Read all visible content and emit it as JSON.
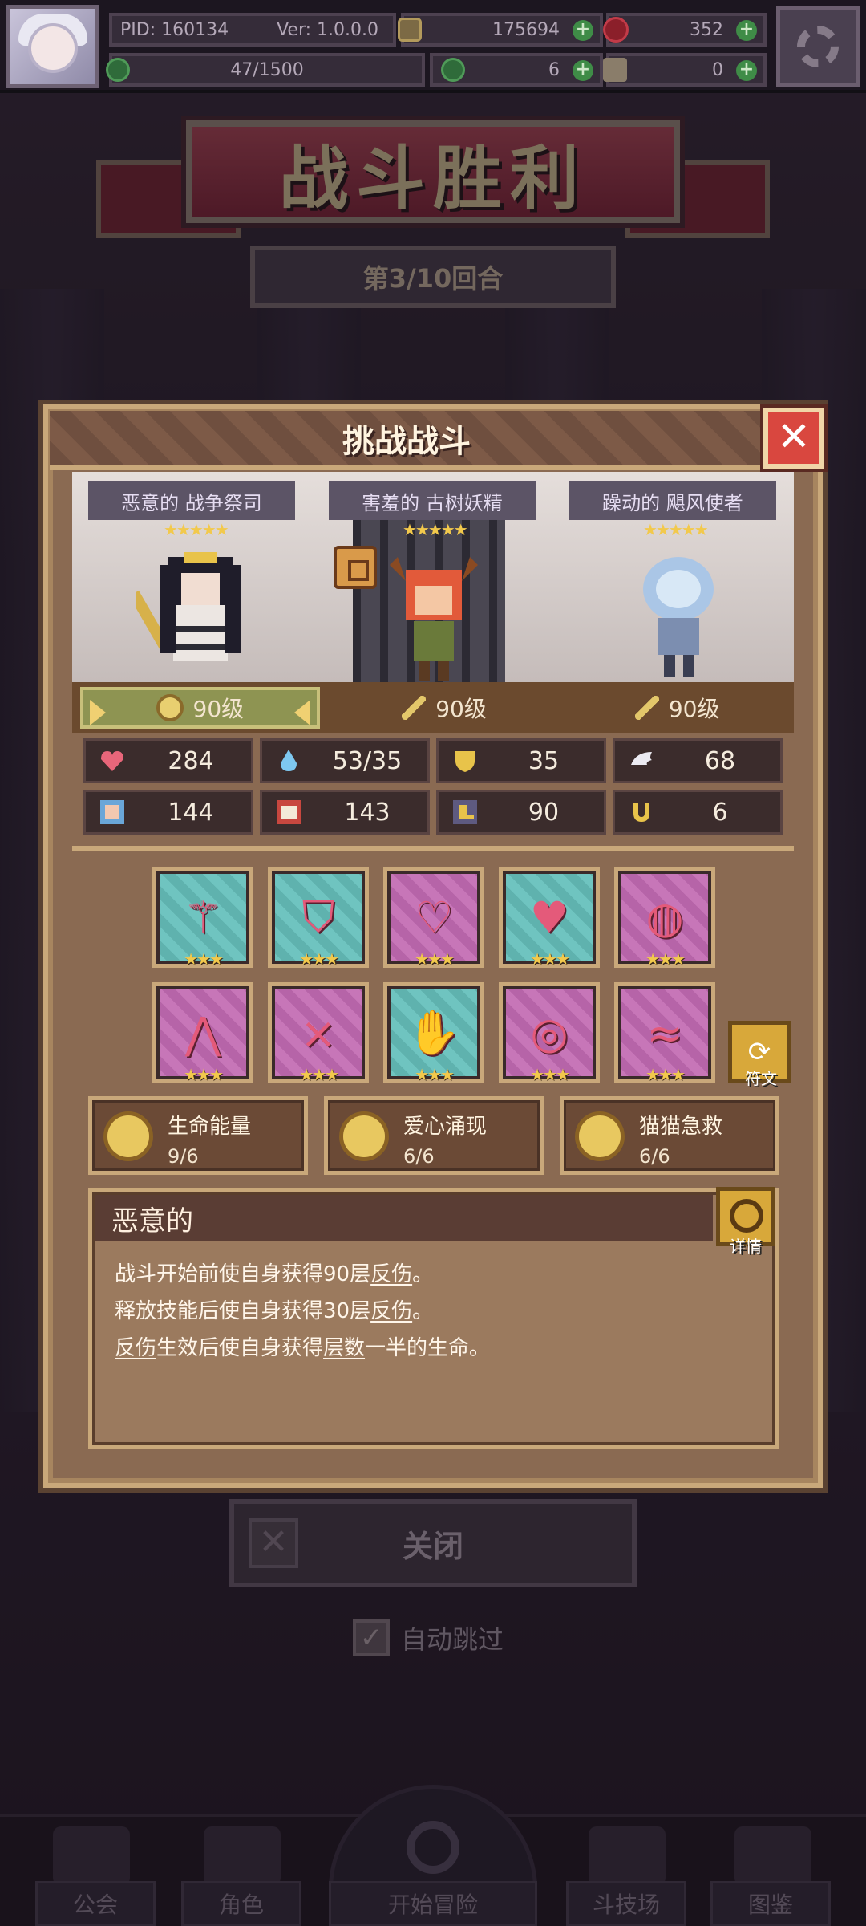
{
  "topbar": {
    "pid": "PID: 160134",
    "version": "Ver: 1.0.0.0",
    "gold": "175694",
    "gems": "352",
    "exp": "47/1500",
    "clover": "6",
    "keys": "0",
    "plus": "+"
  },
  "banner": {
    "title": "战斗胜利",
    "round": "第3/10回合"
  },
  "modal": {
    "title": "挑战战斗",
    "close": "✕",
    "heroes": [
      {
        "name": "恶意的 战争祭司",
        "stars": "★★★★★",
        "level": "90级"
      },
      {
        "name": "害羞的 古树妖精",
        "stars": "★★★★★",
        "level": "90级"
      },
      {
        "name": "躁动的 飓风使者",
        "stars": "★★★★★",
        "level": "90级"
      }
    ],
    "stats": [
      {
        "icon": "heart-icon",
        "value": "284"
      },
      {
        "icon": "mana-drop-icon",
        "value": "53/35"
      },
      {
        "icon": "shield-icon",
        "value": "35"
      },
      {
        "icon": "wing-icon",
        "value": "68"
      },
      {
        "icon": "fist-icon",
        "value": "144"
      },
      {
        "icon": "spellbook-icon",
        "value": "143"
      },
      {
        "icon": "boot-icon",
        "value": "90"
      },
      {
        "icon": "horseshoe-icon",
        "value": "6"
      }
    ],
    "equipment": [
      {
        "icon": "heart-wand-icon",
        "bg": "teal",
        "glyph": "⚚",
        "stars": "★★★"
      },
      {
        "icon": "heart-shield-icon",
        "bg": "teal",
        "glyph": "⛉",
        "stars": "★★★"
      },
      {
        "icon": "heart-necklace-icon",
        "bg": "pink",
        "glyph": "♡",
        "stars": "★★★"
      },
      {
        "icon": "heart-locket-icon",
        "bg": "teal",
        "glyph": "♥",
        "stars": "★★★"
      },
      {
        "icon": "ruby-ring-icon",
        "bg": "pink",
        "glyph": "◍",
        "stars": "★★★"
      },
      {
        "icon": "cat-ear-headband-icon",
        "bg": "pink",
        "glyph": "⋀",
        "stars": "★★★"
      },
      {
        "icon": "ribbon-bow-icon",
        "bg": "pink",
        "glyph": "⨯",
        "stars": "★★★"
      },
      {
        "icon": "cat-paw-glove-icon",
        "bg": "teal",
        "glyph": "✋",
        "stars": "★★★"
      },
      {
        "icon": "gem-collar-icon",
        "bg": "pink",
        "glyph": "◎",
        "stars": "★★★"
      },
      {
        "icon": "winged-boots-icon",
        "bg": "pink",
        "glyph": "≈",
        "stars": "★★★"
      }
    ],
    "rune_label": "符文",
    "rune_glyph": "⟳",
    "set_bonuses": [
      {
        "name": "生命能量",
        "count": "9/6"
      },
      {
        "name": "爱心涌现",
        "count": "6/6"
      },
      {
        "name": "猫猫急救",
        "count": "6/6"
      }
    ],
    "trait": {
      "title": "恶意的",
      "detail_label": "详情",
      "line1_a": "战斗开始前使自身获得90层",
      "line1_b": "反伤",
      "line1_c": "。",
      "line2_a": "释放技能后使自身获得30层",
      "line2_b": "反伤",
      "line2_c": "。",
      "line3_a": "反伤",
      "line3_b": "生效后使自身获得",
      "line3_c": "层数",
      "line3_d": "一半的生命。"
    }
  },
  "footer": {
    "close_label": "关闭",
    "close_glyph": "✕",
    "autoskip_label": "自动跳过",
    "autoskip_checked": "✓"
  },
  "nav": {
    "items": [
      "公会",
      "角色",
      "开始冒险",
      "斗技场",
      "图鉴"
    ]
  },
  "colors": {
    "accent_gold": "#c9a87a",
    "close_red": "#d9473f",
    "star": "#f2c94c"
  }
}
